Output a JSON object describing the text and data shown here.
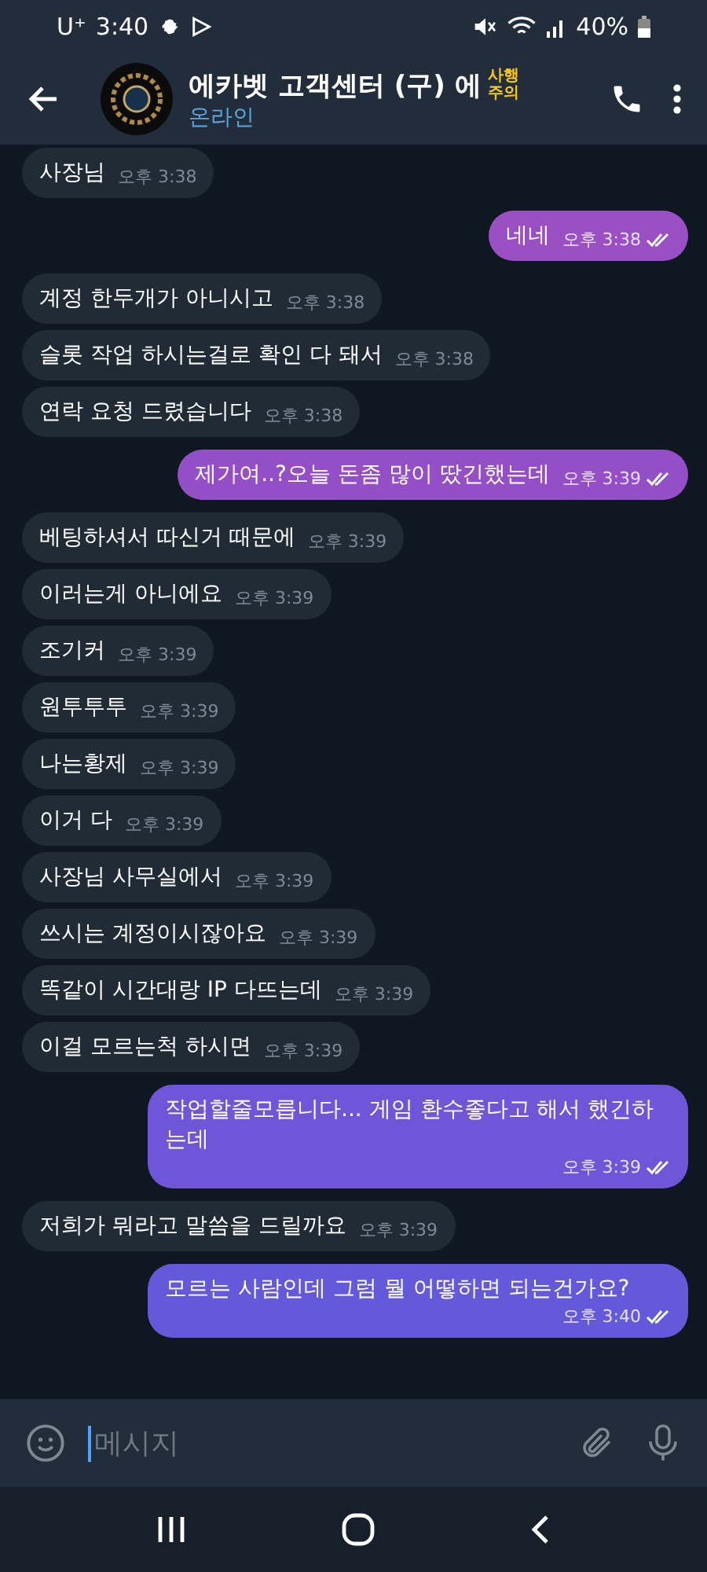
{
  "status_bar": {
    "carrier": "U⁺",
    "time": "3:40",
    "battery": "40%"
  },
  "header": {
    "title": "에카벳 고객센터 (구) 에",
    "badge": "사행주의",
    "subtitle": "온라인"
  },
  "messages": [
    {
      "kind": "in",
      "text": "사장님",
      "time": "오후 3:38"
    },
    {
      "kind": "out",
      "text": "네네",
      "time": "오후 3:38",
      "read": true,
      "color": "#9a4fc2"
    },
    {
      "kind": "in",
      "text": "계정 한두개가 아니시고",
      "time": "오후 3:38"
    },
    {
      "kind": "in",
      "text": "슬롯 작업 하시는걸로 확인 다 돼서",
      "time": "오후 3:38"
    },
    {
      "kind": "in",
      "text": "연락 요청 드렸습니다",
      "time": "오후 3:38"
    },
    {
      "kind": "out",
      "text": "제가여..?오늘 돈좀 많이 땄긴했는데",
      "time": "오후 3:39",
      "read": true,
      "color": "#944fc6"
    },
    {
      "kind": "in",
      "text": "베팅하셔서 따신거 때문에",
      "time": "오후 3:39"
    },
    {
      "kind": "in",
      "text": "이러는게 아니에요",
      "time": "오후 3:39"
    },
    {
      "kind": "in",
      "text": "조기커",
      "time": "오후 3:39"
    },
    {
      "kind": "in",
      "text": "원투투투",
      "time": "오후 3:39"
    },
    {
      "kind": "in",
      "text": "나는황제",
      "time": "오후 3:39"
    },
    {
      "kind": "in",
      "text": "이거 다",
      "time": "오후 3:39"
    },
    {
      "kind": "in",
      "text": "사장님 사무실에서",
      "time": "오후 3:39"
    },
    {
      "kind": "in",
      "text": "쓰시는 계정이시잖아요",
      "time": "오후 3:39"
    },
    {
      "kind": "in",
      "text": "똑같이 시간대랑 IP 다뜨는데",
      "time": "오후 3:39"
    },
    {
      "kind": "in",
      "text": "이걸 모르는척 하시면",
      "time": "오후 3:39"
    },
    {
      "kind": "out",
      "text": "작업할줄모릅니다... 게임 환수좋다고 해서 했긴하는데",
      "time": "오후 3:39",
      "read": true,
      "color": "#6f55d8"
    },
    {
      "kind": "in",
      "text": "저희가 뭐라고 말씀을 드릴까요",
      "time": "오후 3:39"
    },
    {
      "kind": "out",
      "text": "모르는 사람인데 그럼 뭘 어떻하면 되는건가요?",
      "time": "오후 3:40",
      "read": true,
      "color": "#6459da"
    }
  ],
  "composer": {
    "placeholder": "메시지"
  }
}
